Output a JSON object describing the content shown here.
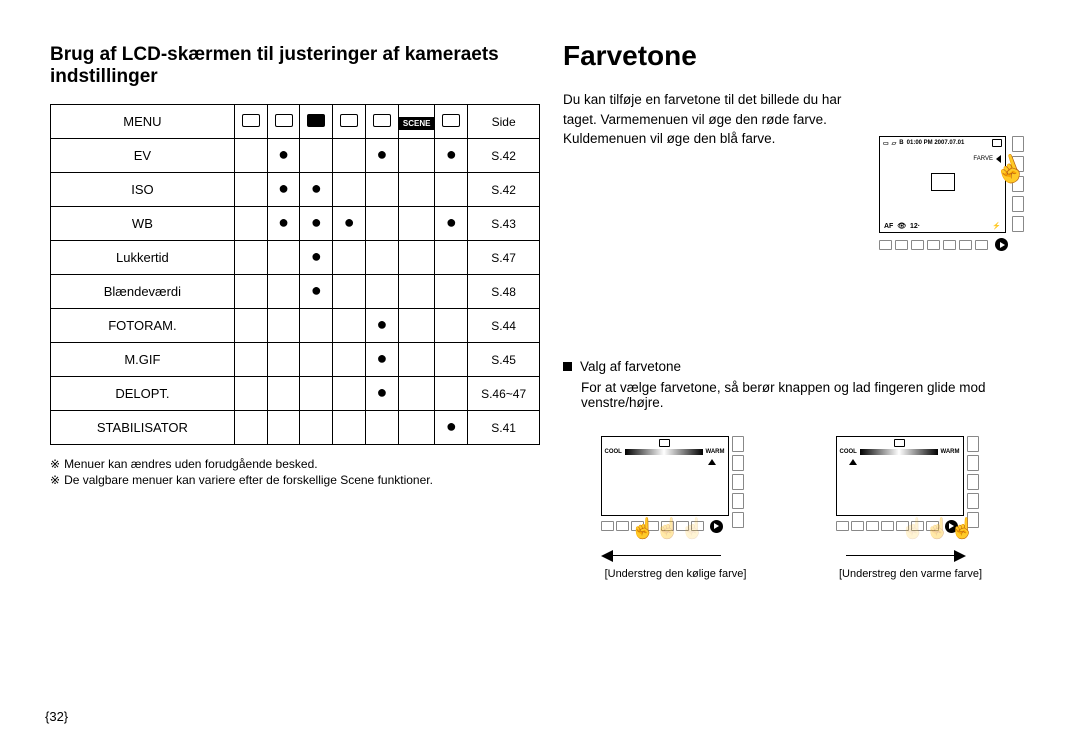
{
  "left": {
    "heading": "Brug af LCD-skærmen til justeringer af kameraets indstillinger",
    "table": {
      "head": {
        "menu": "MENU",
        "side": "Side",
        "scene": "SCENE"
      },
      "rows": [
        {
          "label": "EV",
          "m": [
            "",
            "●",
            "",
            "",
            "●",
            "",
            "●"
          ],
          "page": "S.42"
        },
        {
          "label": "ISO",
          "m": [
            "",
            "●",
            "●",
            "",
            "",
            "",
            ""
          ],
          "page": "S.42"
        },
        {
          "label": "WB",
          "m": [
            "",
            "●",
            "●",
            "●",
            "",
            "",
            "●"
          ],
          "page": "S.43"
        },
        {
          "label": "Lukkertid",
          "m": [
            "",
            "",
            "●",
            "",
            "",
            "",
            ""
          ],
          "page": "S.47"
        },
        {
          "label": "Blændeværdi",
          "m": [
            "",
            "",
            "●",
            "",
            "",
            "",
            ""
          ],
          "page": "S.48"
        },
        {
          "label": "FOTORAM.",
          "m": [
            "",
            "",
            "",
            "",
            "●",
            "",
            ""
          ],
          "page": "S.44"
        },
        {
          "label": "M.GIF",
          "m": [
            "",
            "",
            "",
            "",
            "●",
            "",
            ""
          ],
          "page": "S.45"
        },
        {
          "label": "DELOPT.",
          "m": [
            "",
            "",
            "",
            "",
            "●",
            "",
            ""
          ],
          "page": "S.46~47"
        },
        {
          "label": "STABILISATOR",
          "m": [
            "",
            "",
            "",
            "",
            "",
            "",
            "●"
          ],
          "page": "S.41"
        }
      ]
    },
    "notes": [
      "Menuer kan ændres uden forudgående besked.",
      "De valgbare menuer kan variere efter de forskellige Scene funktioner."
    ],
    "note_mark": "※"
  },
  "right": {
    "heading": "Farvetone",
    "intro": "Du kan tilføje en farvetone til det billede du har taget. Varmemenuen vil øge den røde farve. Kuldemenuen vil øge den blå farve.",
    "lcd": {
      "top": {
        "b": "B",
        "time": "01:00 PM 2007.07.01"
      },
      "farve": "FARVE",
      "bot": {
        "af": "AF",
        "iso": "12·"
      }
    },
    "valg": {
      "heading": "Valg af farvetone",
      "text": "For at vælge farvetone, så berør knappen og lad fingeren glide mod venstre/højre."
    },
    "mini": {
      "cool": "COOL",
      "warm": "WARM",
      "cap_left": "[Understreg den kølige farve]",
      "cap_right": "[Understreg den varme farve]"
    }
  },
  "page_number": "{32}"
}
